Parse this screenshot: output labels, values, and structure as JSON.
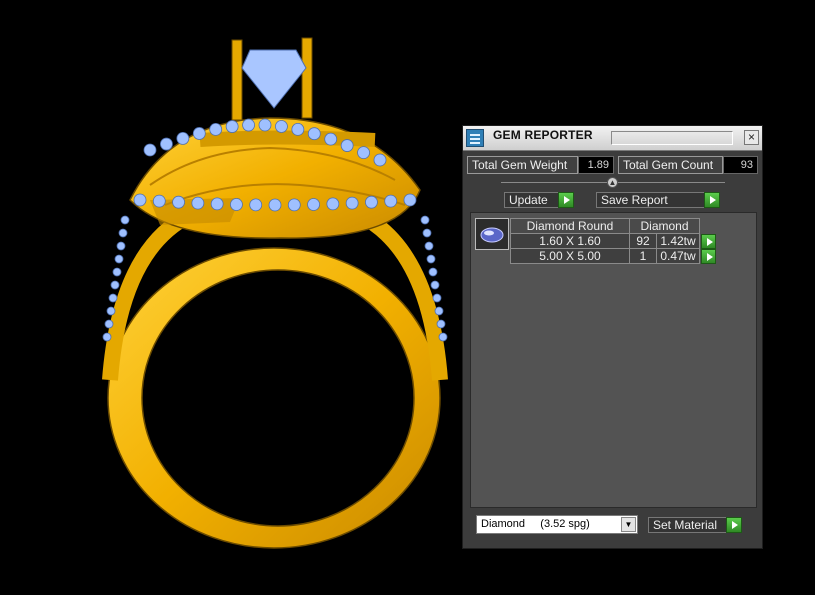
{
  "panel": {
    "title": "GEM REPORTER",
    "close_symbol": "×",
    "total_gem_weight_label": "Total Gem Weight",
    "total_gem_weight_value": "1.89",
    "total_gem_count_label": "Total Gem Count",
    "total_gem_count_value": "93",
    "update_label": "Update",
    "save_report_label": "Save Report",
    "table": {
      "headers": [
        "Diamond Round",
        "Diamond"
      ],
      "rows": [
        {
          "size": "1.60 X 1.60",
          "count": "92",
          "weight": "1.42tw"
        },
        {
          "size": "5.00 X 5.00",
          "count": "1",
          "weight": "0.47tw"
        }
      ]
    },
    "material_select": {
      "value": "Diamond     (3.52 spg)"
    },
    "set_material_label": "Set Material"
  },
  "icons": {
    "app": "gem-reporter-app-icon",
    "close": "close-icon",
    "collapse": "chevron-up-icon",
    "go": "green-play-arrow-icon",
    "thumbnail": "round-diamond-icon",
    "dropdown": "chevron-down-icon"
  },
  "colors": {
    "gold": "#f2b800",
    "gem_blue": "#9fc0ff",
    "panel_bg": "#3c3c3c",
    "go_green": "#3fb32f"
  }
}
